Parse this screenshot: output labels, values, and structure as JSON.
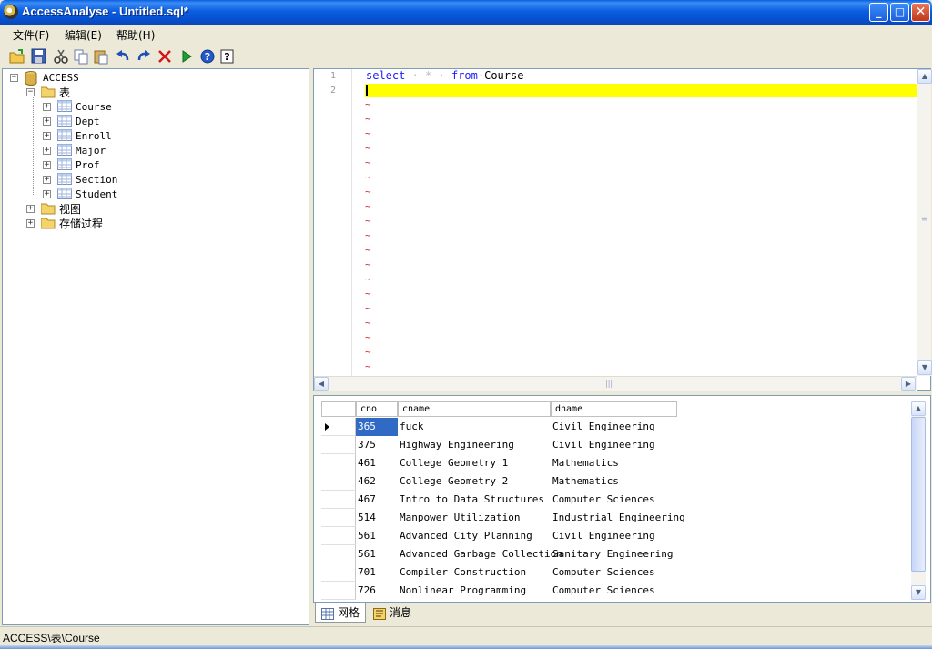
{
  "window": {
    "title": "AccessAnalyse - Untitled.sql*",
    "min_glyph": "_",
    "max_glyph": "□",
    "close_glyph": "✕"
  },
  "menu": [
    "文件(F)",
    "编辑(E)",
    "帮助(H)"
  ],
  "toolbar": {
    "icons": [
      "open-folder-icon",
      "save-icon",
      "cut-icon",
      "copy-icon",
      "paste-icon",
      "undo-icon",
      "redo-icon",
      "delete-icon",
      "run-icon",
      "help-icon",
      "context-help-icon"
    ]
  },
  "tree": {
    "root": "ACCESS",
    "tables_label": "表",
    "tables": [
      "Course",
      "Dept",
      "Enroll",
      "Major",
      "Prof",
      "Section",
      "Student"
    ],
    "views_label": "视图",
    "procs_label": "存储过程"
  },
  "editor": {
    "line_numbers": [
      "1",
      "2"
    ],
    "line1": {
      "kw1": "select",
      "star": "*",
      "kw2": "from",
      "ident": "Course"
    },
    "tilde": "~",
    "current_line_color": "#ffff00",
    "keyword_color": "#2020ff"
  },
  "grid": {
    "columns": [
      "cno",
      "cname",
      "dname"
    ],
    "rows": [
      [
        "365",
        "fuck",
        "Civil Engineering"
      ],
      [
        "375",
        "Highway Engineering",
        "Civil Engineering"
      ],
      [
        "461",
        "College Geometry 1",
        "Mathematics"
      ],
      [
        "462",
        "College Geometry 2",
        "Mathematics"
      ],
      [
        "467",
        "Intro to Data Structures",
        "Computer Sciences"
      ],
      [
        "514",
        "Manpower Utilization",
        "Industrial Engineering"
      ],
      [
        "561",
        "Advanced City Planning",
        "Civil Engineering"
      ],
      [
        "561",
        "Advanced Garbage Collection",
        "Sanitary Engineering"
      ],
      [
        "701",
        "Compiler Construction",
        "Computer Sciences"
      ],
      [
        "726",
        "Nonlinear Programming",
        "Computer Sciences"
      ]
    ],
    "selected_color": "#316ac5"
  },
  "tabs": [
    "网格",
    "消息"
  ],
  "status": {
    "path": "ACCESS\\表\\Course"
  }
}
